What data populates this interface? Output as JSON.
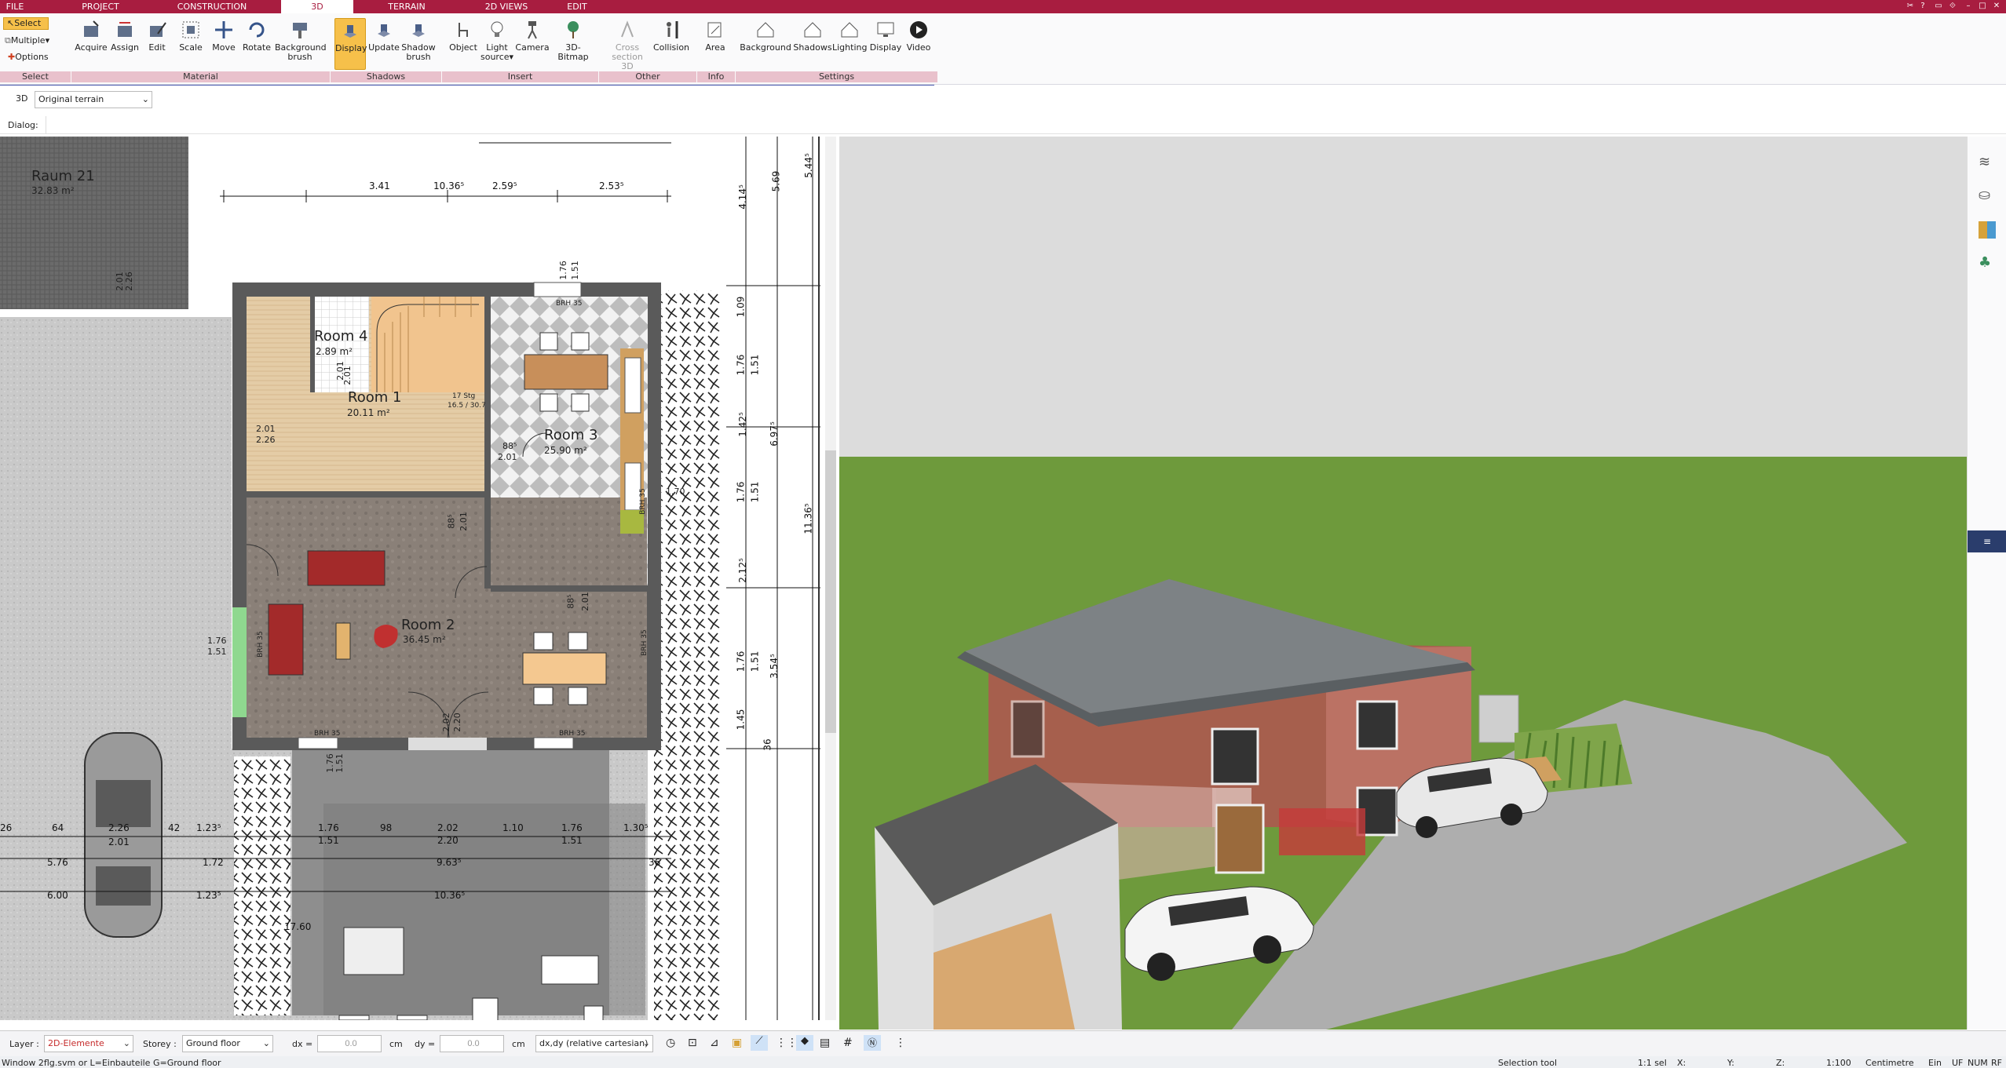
{
  "menu": {
    "tabs": [
      "FILE",
      "PROJECT",
      "CONSTRUCTION",
      "3D",
      "TERRAIN",
      "2D VIEWS",
      "EDIT"
    ]
  },
  "ribbon": {
    "select": {
      "select": "Select",
      "multiple": "Multiple",
      "options": "Options"
    },
    "material": [
      "Acquire",
      "Assign",
      "Edit",
      "Scale",
      "Move",
      "Rotate",
      "Background",
      "brush"
    ],
    "shadows": [
      "Display",
      "Update",
      "Shadow",
      "brush"
    ],
    "insert": [
      "Object",
      "Light",
      "source",
      "Camera",
      "3D-Bitmap"
    ],
    "other": [
      "Cross",
      "section 3D",
      "Collision"
    ],
    "info": [
      "Area"
    ],
    "settings": [
      "Background",
      "Shadows",
      "Lighting",
      "Display",
      "Video"
    ],
    "groups": [
      "Select",
      "Material",
      "Shadows",
      "Insert",
      "Other",
      "Info",
      "Settings"
    ]
  },
  "toolbar": {
    "mode": "3D",
    "terrain": "Original terrain",
    "dialog": "Dialog:"
  },
  "plan": {
    "rooms": [
      {
        "name": "Raum 21",
        "area": "32.83 m²"
      },
      {
        "name": "Room 4",
        "area": "2.89 m²"
      },
      {
        "name": "Room 1",
        "area": "20.11 m²"
      },
      {
        "name": "Room 3",
        "area": "25.90 m²"
      },
      {
        "name": "Room 2",
        "area": "36.45 m²"
      }
    ],
    "dims_top": [
      "3.41",
      "10.36⁵",
      "2.59⁵",
      "2.53⁵"
    ],
    "dims_right": [
      "5.69",
      "5.44⁵",
      "4.14⁵",
      "1.09",
      "1.76",
      "1.51",
      "1.42⁵",
      "6.97⁵",
      "1.76",
      "1.51",
      "11.36⁵",
      "2.12⁵",
      "1.76",
      "1.51",
      "3.54⁵",
      "1.45",
      "36"
    ],
    "dims_bottom": [
      "26",
      "64",
      "2.26",
      "2.01",
      "42",
      "1.23⁵",
      "5.76",
      "1.72",
      "6.00",
      "1.23⁵",
      "1.76",
      "1.51",
      "98",
      "2.02",
      "2.20",
      "1.10",
      "1.76",
      "1.51",
      "1.30⁵",
      "9.63⁵",
      "36",
      "10.36⁵",
      "17.60"
    ],
    "misc": [
      "BRH 35",
      "BRH 35",
      "BRH 35",
      "BRH 35",
      "2.01",
      "2.26",
      "88⁵",
      "2.01",
      "88⁵",
      "2.01",
      "17 Stg",
      "16.5 / 30.7",
      "1.76",
      "1.51",
      "1.76",
      "1.51",
      "BRH 35",
      "BRH 35",
      "1.70",
      "2.01",
      "2.01",
      "88⁵",
      "2.01",
      "2.26",
      "2.02",
      "2.20",
      "1.76",
      "1.51",
      "2.01"
    ]
  },
  "status": {
    "layer_label": "Layer :",
    "layer_value": "2D-Elemente",
    "storey_label": "Storey :",
    "storey_value": "Ground floor",
    "dx_label": "dx =",
    "dx_value": "0.0",
    "dy_label": "dy =",
    "dy_value": "0.0",
    "unit": "cm",
    "unit2": "cm",
    "coord_mode": "dx,dy (relative cartesian)"
  },
  "footer": {
    "left": "Window 2flg.svm or L=Einbauteile G=Ground floor",
    "tool": "Selection tool",
    "sel": "1:1 sel",
    "x": "X:",
    "y": "Y:",
    "z": "Z:",
    "scale": "1:100",
    "units": "Centimetre",
    "ein": "Ein",
    "uf": "UF",
    "num": "NUM",
    "rf": "RF"
  },
  "colors": {
    "brand": "#a81d40",
    "selected": "#f6c04a",
    "group_bar": "#e9c1cc"
  }
}
